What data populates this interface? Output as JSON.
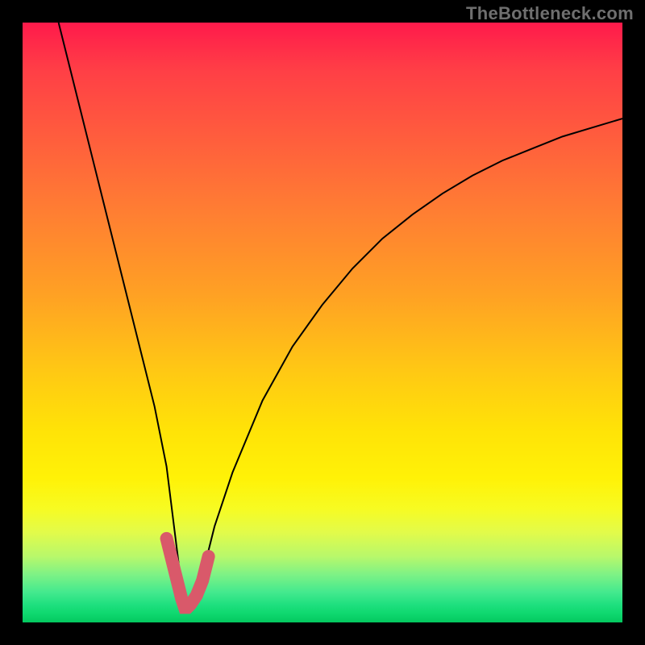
{
  "watermark": "TheBottleneck.com",
  "chart_data": {
    "type": "line",
    "title": "",
    "xlabel": "",
    "ylabel": "",
    "xlim": [
      0,
      100
    ],
    "ylim": [
      0,
      100
    ],
    "grid": false,
    "legend": false,
    "background_gradient": {
      "direction": "vertical",
      "stops": [
        {
          "pos": 0,
          "color": "#ff1a4b"
        },
        {
          "pos": 50,
          "color": "#ffc814"
        },
        {
          "pos": 80,
          "color": "#fff207"
        },
        {
          "pos": 100,
          "color": "#04c85f"
        }
      ]
    },
    "series": [
      {
        "name": "bottleneck-curve",
        "x": [
          6,
          8,
          10,
          12,
          14,
          16,
          18,
          20,
          22,
          24,
          26,
          26.5,
          27,
          28,
          29,
          30,
          32,
          35,
          40,
          45,
          50,
          55,
          60,
          65,
          70,
          75,
          80,
          85,
          90,
          95,
          100
        ],
        "values": [
          100,
          92,
          84,
          76,
          68,
          60,
          52,
          44,
          36,
          26,
          10,
          4,
          2.5,
          2.5,
          4,
          8,
          16,
          25,
          37,
          46,
          53,
          59,
          64,
          68,
          71.5,
          74.5,
          77,
          79,
          81,
          82.5,
          84
        ]
      }
    ],
    "highlight_segment": {
      "name": "bottleneck-minimum",
      "color": "#d9596a",
      "x": [
        24,
        25,
        26,
        26.5,
        27,
        27.5,
        28,
        29,
        30,
        31
      ],
      "values": [
        14,
        10,
        6,
        4,
        2.5,
        2.5,
        3,
        4.5,
        7,
        11
      ]
    }
  }
}
